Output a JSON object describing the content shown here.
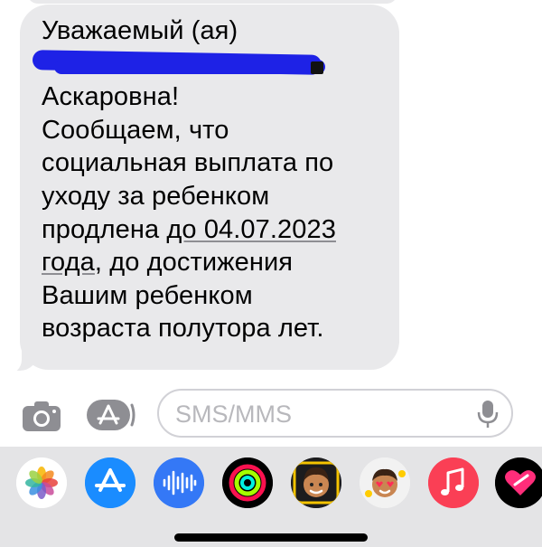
{
  "message": {
    "lines": [
      "Уважаемый (ая)",
      "",
      "Аскаровна!",
      "Сообщаем, что",
      "социальная выплата по",
      "уходу за ребенком"
    ],
    "line_extended_pre": "продлена ",
    "line_extended_link": "до 04.07.2023",
    "line_year_link": "года",
    "line_year_post": ", до достижения",
    "lines_end": [
      "Вашим ребенком",
      "возраста полутора лет."
    ]
  },
  "input": {
    "placeholder": "SMS/MMS",
    "value": ""
  },
  "icons": {
    "camera": "camera-icon",
    "apps": "app-store-icon",
    "mic": "microphone-icon",
    "dock": [
      "photos-icon",
      "app-store-icon",
      "audio-message-icon",
      "fitness-activity-icon",
      "memoji-icon",
      "memoji-stickers-icon",
      "music-icon",
      "digital-touch-icon"
    ]
  },
  "colors": {
    "bubble": "#e9e9eb",
    "redaction": "#1e22e6",
    "app_store_blue": "#1a8cff",
    "music_red": "#fa3f55",
    "audio_blue": "#3478f6"
  }
}
